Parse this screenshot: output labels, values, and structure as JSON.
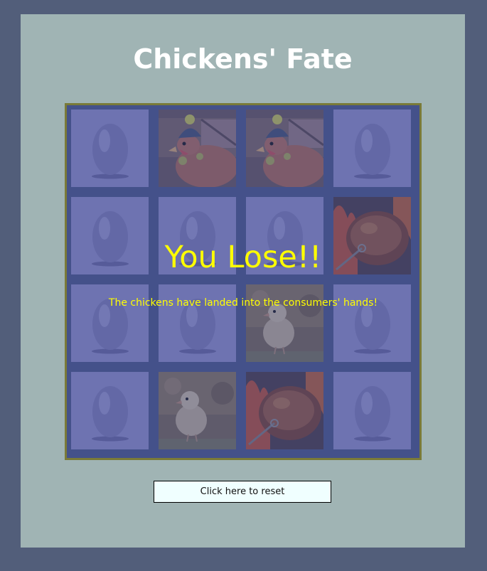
{
  "title": "Chickens' Fate",
  "board": {
    "cards": [
      "egg",
      "hen",
      "hen",
      "egg",
      "egg",
      "egg",
      "egg",
      "roast",
      "egg",
      "egg",
      "chick",
      "egg",
      "egg",
      "chick",
      "roast",
      "egg"
    ],
    "state": "revealed"
  },
  "result": {
    "heading": "You Lose!!",
    "message": "The chickens have landed into the consumers' hands!"
  },
  "reset_label": "Click here to reset",
  "colors": {
    "page_bg": "#525e7a",
    "panel_bg": "#a0b4b4",
    "board_border": "#7a7a38",
    "card_bg": "#8585c0",
    "result_text": "#ffff00"
  },
  "icons": {
    "egg": "egg-icon",
    "hen": "hen-in-hat-icon",
    "chick": "chick-icon",
    "roast": "roast-chicken-icon"
  }
}
